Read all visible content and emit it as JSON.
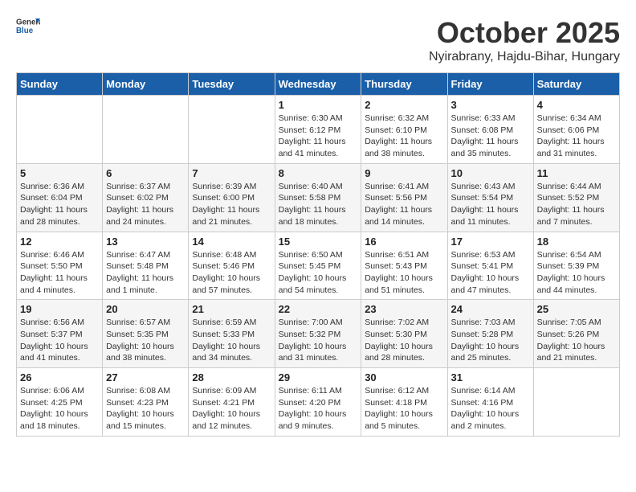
{
  "logo": {
    "general": "General",
    "blue": "Blue"
  },
  "title": {
    "month": "October 2025",
    "location": "Nyirabrany, Hajdu-Bihar, Hungary"
  },
  "headers": [
    "Sunday",
    "Monday",
    "Tuesday",
    "Wednesday",
    "Thursday",
    "Friday",
    "Saturday"
  ],
  "weeks": [
    [
      {
        "day": "",
        "info": ""
      },
      {
        "day": "",
        "info": ""
      },
      {
        "day": "",
        "info": ""
      },
      {
        "day": "1",
        "info": "Sunrise: 6:30 AM\nSunset: 6:12 PM\nDaylight: 11 hours\nand 41 minutes."
      },
      {
        "day": "2",
        "info": "Sunrise: 6:32 AM\nSunset: 6:10 PM\nDaylight: 11 hours\nand 38 minutes."
      },
      {
        "day": "3",
        "info": "Sunrise: 6:33 AM\nSunset: 6:08 PM\nDaylight: 11 hours\nand 35 minutes."
      },
      {
        "day": "4",
        "info": "Sunrise: 6:34 AM\nSunset: 6:06 PM\nDaylight: 11 hours\nand 31 minutes."
      }
    ],
    [
      {
        "day": "5",
        "info": "Sunrise: 6:36 AM\nSunset: 6:04 PM\nDaylight: 11 hours\nand 28 minutes."
      },
      {
        "day": "6",
        "info": "Sunrise: 6:37 AM\nSunset: 6:02 PM\nDaylight: 11 hours\nand 24 minutes."
      },
      {
        "day": "7",
        "info": "Sunrise: 6:39 AM\nSunset: 6:00 PM\nDaylight: 11 hours\nand 21 minutes."
      },
      {
        "day": "8",
        "info": "Sunrise: 6:40 AM\nSunset: 5:58 PM\nDaylight: 11 hours\nand 18 minutes."
      },
      {
        "day": "9",
        "info": "Sunrise: 6:41 AM\nSunset: 5:56 PM\nDaylight: 11 hours\nand 14 minutes."
      },
      {
        "day": "10",
        "info": "Sunrise: 6:43 AM\nSunset: 5:54 PM\nDaylight: 11 hours\nand 11 minutes."
      },
      {
        "day": "11",
        "info": "Sunrise: 6:44 AM\nSunset: 5:52 PM\nDaylight: 11 hours\nand 7 minutes."
      }
    ],
    [
      {
        "day": "12",
        "info": "Sunrise: 6:46 AM\nSunset: 5:50 PM\nDaylight: 11 hours\nand 4 minutes."
      },
      {
        "day": "13",
        "info": "Sunrise: 6:47 AM\nSunset: 5:48 PM\nDaylight: 11 hours\nand 1 minute."
      },
      {
        "day": "14",
        "info": "Sunrise: 6:48 AM\nSunset: 5:46 PM\nDaylight: 10 hours\nand 57 minutes."
      },
      {
        "day": "15",
        "info": "Sunrise: 6:50 AM\nSunset: 5:45 PM\nDaylight: 10 hours\nand 54 minutes."
      },
      {
        "day": "16",
        "info": "Sunrise: 6:51 AM\nSunset: 5:43 PM\nDaylight: 10 hours\nand 51 minutes."
      },
      {
        "day": "17",
        "info": "Sunrise: 6:53 AM\nSunset: 5:41 PM\nDaylight: 10 hours\nand 47 minutes."
      },
      {
        "day": "18",
        "info": "Sunrise: 6:54 AM\nSunset: 5:39 PM\nDaylight: 10 hours\nand 44 minutes."
      }
    ],
    [
      {
        "day": "19",
        "info": "Sunrise: 6:56 AM\nSunset: 5:37 PM\nDaylight: 10 hours\nand 41 minutes."
      },
      {
        "day": "20",
        "info": "Sunrise: 6:57 AM\nSunset: 5:35 PM\nDaylight: 10 hours\nand 38 minutes."
      },
      {
        "day": "21",
        "info": "Sunrise: 6:59 AM\nSunset: 5:33 PM\nDaylight: 10 hours\nand 34 minutes."
      },
      {
        "day": "22",
        "info": "Sunrise: 7:00 AM\nSunset: 5:32 PM\nDaylight: 10 hours\nand 31 minutes."
      },
      {
        "day": "23",
        "info": "Sunrise: 7:02 AM\nSunset: 5:30 PM\nDaylight: 10 hours\nand 28 minutes."
      },
      {
        "day": "24",
        "info": "Sunrise: 7:03 AM\nSunset: 5:28 PM\nDaylight: 10 hours\nand 25 minutes."
      },
      {
        "day": "25",
        "info": "Sunrise: 7:05 AM\nSunset: 5:26 PM\nDaylight: 10 hours\nand 21 minutes."
      }
    ],
    [
      {
        "day": "26",
        "info": "Sunrise: 6:06 AM\nSunset: 4:25 PM\nDaylight: 10 hours\nand 18 minutes."
      },
      {
        "day": "27",
        "info": "Sunrise: 6:08 AM\nSunset: 4:23 PM\nDaylight: 10 hours\nand 15 minutes."
      },
      {
        "day": "28",
        "info": "Sunrise: 6:09 AM\nSunset: 4:21 PM\nDaylight: 10 hours\nand 12 minutes."
      },
      {
        "day": "29",
        "info": "Sunrise: 6:11 AM\nSunset: 4:20 PM\nDaylight: 10 hours\nand 9 minutes."
      },
      {
        "day": "30",
        "info": "Sunrise: 6:12 AM\nSunset: 4:18 PM\nDaylight: 10 hours\nand 5 minutes."
      },
      {
        "day": "31",
        "info": "Sunrise: 6:14 AM\nSunset: 4:16 PM\nDaylight: 10 hours\nand 2 minutes."
      },
      {
        "day": "",
        "info": ""
      }
    ]
  ]
}
